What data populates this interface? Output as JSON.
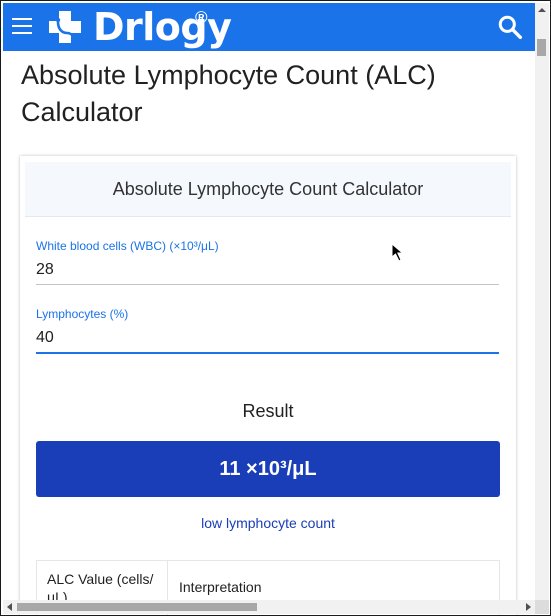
{
  "header": {
    "brand": "Drlogy",
    "registered": "®",
    "menu_icon": "hamburger-menu-icon",
    "search_icon": "search-icon",
    "color": "#1a73e8"
  },
  "page": {
    "title": "Absolute Lymphocyte Count (ALC) Calculator"
  },
  "calculator": {
    "heading": "Absolute Lymphocyte Count Calculator",
    "wbc_label": "White blood cells (WBC) (×10³/μL)",
    "wbc_value": "28",
    "lymph_label": "Lymphocytes (%)",
    "lymph_value": "40",
    "result_label": "Result",
    "result_value": "11 ×10³/μL",
    "result_color": "#1a3eb8",
    "interpretation": "low lymphocyte count"
  },
  "table": {
    "headers": [
      "ALC Value (cells/μL)",
      "Interpretation"
    ]
  }
}
